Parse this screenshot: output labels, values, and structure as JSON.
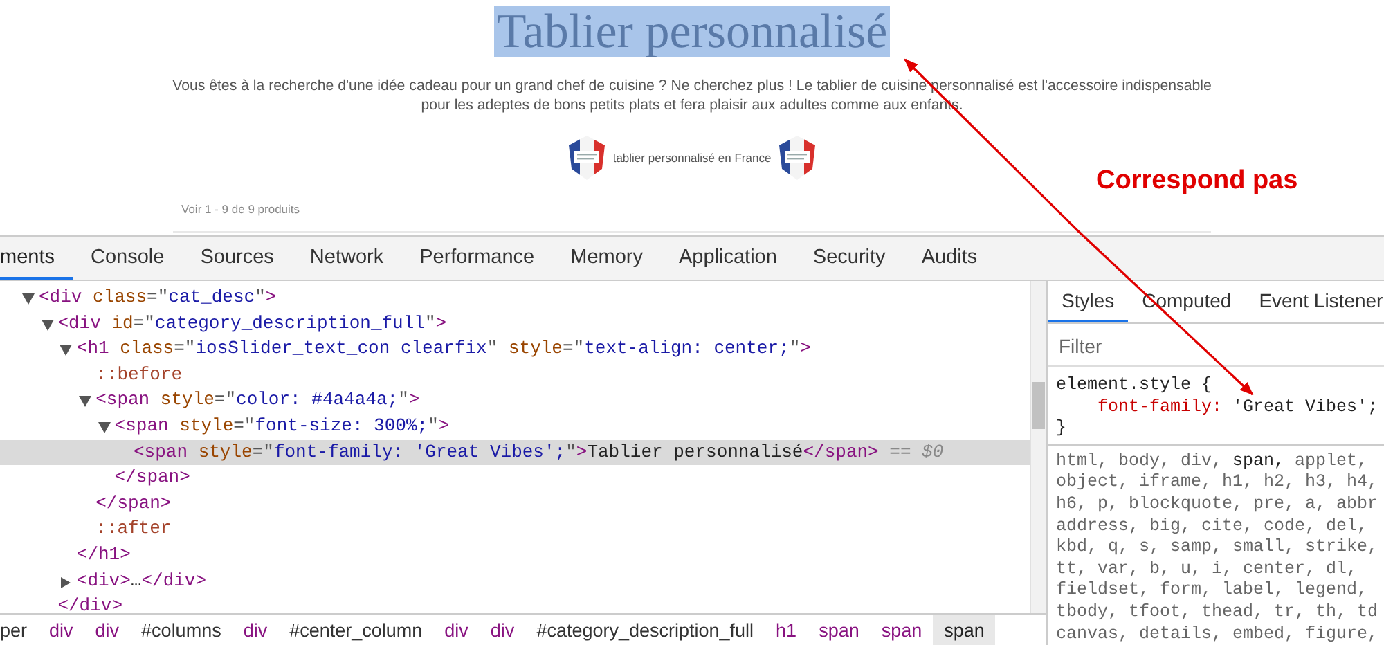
{
  "page": {
    "title": {
      "text": "Tablier personnalisé",
      "highlighted": true
    },
    "description": [
      "Vous êtes à la recherche d'une idée cadeau pour un grand chef de cuisine ? Ne cherchez plus ! Le tablier de cuisine personnalisé est l'accessoire indispensable",
      "pour les adeptes de bons petits plats et fera plaisir aux adultes comme aux enfants."
    ],
    "badge_caption": "tablier personnalisé en France",
    "product_count": "Voir 1 - 9 de 9 produits"
  },
  "annotation": {
    "text": "Correspond pas"
  },
  "devtools": {
    "tabs": [
      {
        "label": "ments",
        "selected": true
      },
      {
        "label": "Console",
        "selected": false
      },
      {
        "label": "Sources",
        "selected": false
      },
      {
        "label": "Network",
        "selected": false
      },
      {
        "label": "Performance",
        "selected": false
      },
      {
        "label": "Memory",
        "selected": false
      },
      {
        "label": "Application",
        "selected": false
      },
      {
        "label": "Security",
        "selected": false
      },
      {
        "label": "Audits",
        "selected": false
      }
    ],
    "dom_tree": [
      {
        "expanded": true,
        "selected": false,
        "tokens": [
          {
            "kind": "tag",
            "text": "<div"
          },
          {
            "kind": "attr",
            "text": " class"
          },
          {
            "kind": "punct",
            "text": "=\""
          },
          {
            "kind": "value",
            "text": "cat_desc"
          },
          {
            "kind": "punct",
            "text": "\""
          },
          {
            "kind": "tag",
            "text": ">"
          }
        ],
        "children": [
          {
            "expanded": true,
            "selected": false,
            "tokens": [
              {
                "kind": "tag",
                "text": "<div"
              },
              {
                "kind": "attr",
                "text": " id"
              },
              {
                "kind": "punct",
                "text": "=\""
              },
              {
                "kind": "value",
                "text": "category_description_full"
              },
              {
                "kind": "punct",
                "text": "\""
              },
              {
                "kind": "tag",
                "text": ">"
              }
            ],
            "close": [
              {
                "kind": "tag",
                "text": "</div>"
              }
            ],
            "children": [
              {
                "expanded": true,
                "selected": false,
                "tokens": [
                  {
                    "kind": "tag",
                    "text": "<h1"
                  },
                  {
                    "kind": "attr",
                    "text": " class"
                  },
                  {
                    "kind": "punct",
                    "text": "=\""
                  },
                  {
                    "kind": "value",
                    "text": "iosSlider_text_con clearfix"
                  },
                  {
                    "kind": "punct",
                    "text": "\""
                  },
                  {
                    "kind": "attr",
                    "text": " style"
                  },
                  {
                    "kind": "punct",
                    "text": "=\""
                  },
                  {
                    "kind": "value",
                    "text": "text-align: center;"
                  },
                  {
                    "kind": "punct",
                    "text": "\""
                  },
                  {
                    "kind": "tag",
                    "text": ">"
                  }
                ],
                "close": [
                  {
                    "kind": "tag",
                    "text": "</h1>"
                  }
                ],
                "children": [
                  {
                    "selected": false,
                    "tokens": [
                      {
                        "kind": "pseudo",
                        "text": "::before"
                      }
                    ]
                  },
                  {
                    "expanded": true,
                    "selected": false,
                    "tokens": [
                      {
                        "kind": "tag",
                        "text": "<span"
                      },
                      {
                        "kind": "attr",
                        "text": " style"
                      },
                      {
                        "kind": "punct",
                        "text": "=\""
                      },
                      {
                        "kind": "value",
                        "text": "color: #4a4a4a;"
                      },
                      {
                        "kind": "punct",
                        "text": "\""
                      },
                      {
                        "kind": "tag",
                        "text": ">"
                      }
                    ],
                    "close": [
                      {
                        "kind": "tag",
                        "text": "</span>"
                      }
                    ],
                    "children": [
                      {
                        "expanded": true,
                        "selected": false,
                        "tokens": [
                          {
                            "kind": "tag",
                            "text": "<span"
                          },
                          {
                            "kind": "attr",
                            "text": " style"
                          },
                          {
                            "kind": "punct",
                            "text": "=\""
                          },
                          {
                            "kind": "value",
                            "text": "font-size: 300%;"
                          },
                          {
                            "kind": "punct",
                            "text": "\""
                          },
                          {
                            "kind": "tag",
                            "text": ">"
                          }
                        ],
                        "close": [
                          {
                            "kind": "tag",
                            "text": "</span>"
                          }
                        ],
                        "children": [
                          {
                            "selected": true,
                            "tokens": [
                              {
                                "kind": "tag",
                                "text": "<span"
                              },
                              {
                                "kind": "attr",
                                "text": " style"
                              },
                              {
                                "kind": "punct",
                                "text": "=\""
                              },
                              {
                                "kind": "value",
                                "text": "font-family: 'Great Vibes';"
                              },
                              {
                                "kind": "punct",
                                "text": "\""
                              },
                              {
                                "kind": "tag",
                                "text": ">"
                              },
                              {
                                "kind": "text",
                                "text": "Tablier personnalisé"
                              },
                              {
                                "kind": "tag",
                                "text": "</span>"
                              },
                              {
                                "kind": "hint",
                                "text": " == $0"
                              }
                            ]
                          }
                        ]
                      }
                    ]
                  },
                  {
                    "selected": false,
                    "tokens": [
                      {
                        "kind": "pseudo",
                        "text": "::after"
                      }
                    ]
                  }
                ]
              },
              {
                "expanded": false,
                "selected": false,
                "tokens": [
                  {
                    "kind": "tag",
                    "text": "<div>"
                  },
                  {
                    "kind": "text",
                    "text": "…"
                  },
                  {
                    "kind": "tag",
                    "text": "</div>"
                  }
                ]
              }
            ]
          }
        ]
      }
    ],
    "breadcrumbs": [
      {
        "label": "per",
        "kind": "id",
        "selected": false
      },
      {
        "label": "div",
        "kind": "tag",
        "selected": false
      },
      {
        "label": "div",
        "kind": "tag",
        "selected": false
      },
      {
        "label": "#columns",
        "kind": "id",
        "selected": false
      },
      {
        "label": "div",
        "kind": "tag",
        "selected": false
      },
      {
        "label": "#center_column",
        "kind": "id",
        "selected": false
      },
      {
        "label": "div",
        "kind": "tag",
        "selected": false
      },
      {
        "label": "div",
        "kind": "tag",
        "selected": false
      },
      {
        "label": "#category_description_full",
        "kind": "id",
        "selected": false
      },
      {
        "label": "h1",
        "kind": "tag",
        "selected": false
      },
      {
        "label": "span",
        "kind": "tag",
        "selected": false
      },
      {
        "label": "span",
        "kind": "tag",
        "selected": false
      },
      {
        "label": "span",
        "kind": "tag",
        "selected": true
      }
    ],
    "styles_tabs": [
      {
        "label": "Styles",
        "selected": true
      },
      {
        "label": "Computed",
        "selected": false
      },
      {
        "label": "Event Listener",
        "selected": false
      }
    ],
    "filter": {
      "placeholder": "Filter"
    },
    "element_style": {
      "selector": "element.style {",
      "declarations": [
        {
          "property": "font-family:",
          "value": "'Great Vibes';"
        }
      ],
      "close": "}"
    },
    "rule_selector_lines": [
      "html, body, div, **span,** applet,",
      "object, iframe, h1, h2, h3, h4,",
      "h6, p, blockquote, pre, a, abbr",
      "address, big, cite, code, del,",
      "kbd, q, s, samp, small, strike,",
      "tt, var, b, u, i, center, dl,",
      "fieldset, form, label, legend,",
      "tbody, tfoot, thead, tr, th, td",
      "canvas, details, embed, figure,"
    ]
  }
}
